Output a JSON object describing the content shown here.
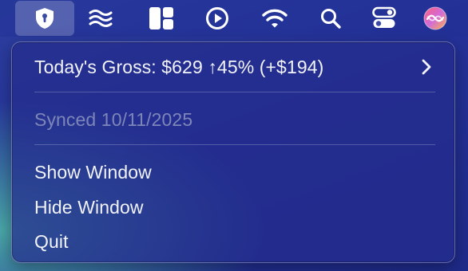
{
  "menubar": {
    "icons": [
      {
        "name": "shield-lock-icon",
        "active": true
      },
      {
        "name": "waves-icon"
      },
      {
        "name": "layout-grid-icon"
      },
      {
        "name": "play-circle-icon"
      },
      {
        "name": "wifi-icon"
      },
      {
        "name": "search-icon"
      },
      {
        "name": "control-center-icon"
      },
      {
        "name": "siri-icon"
      }
    ],
    "colors": {
      "icon": "#ffffff",
      "active_bg": "rgba(255,255,255,0.22)"
    }
  },
  "menu": {
    "gross_label": "Today's Gross: $629 ↑45% (+$194)",
    "synced_label": "Synced 10/11/2025",
    "show_window": "Show Window",
    "hide_window": "Hide Window",
    "quit": "Quit"
  }
}
